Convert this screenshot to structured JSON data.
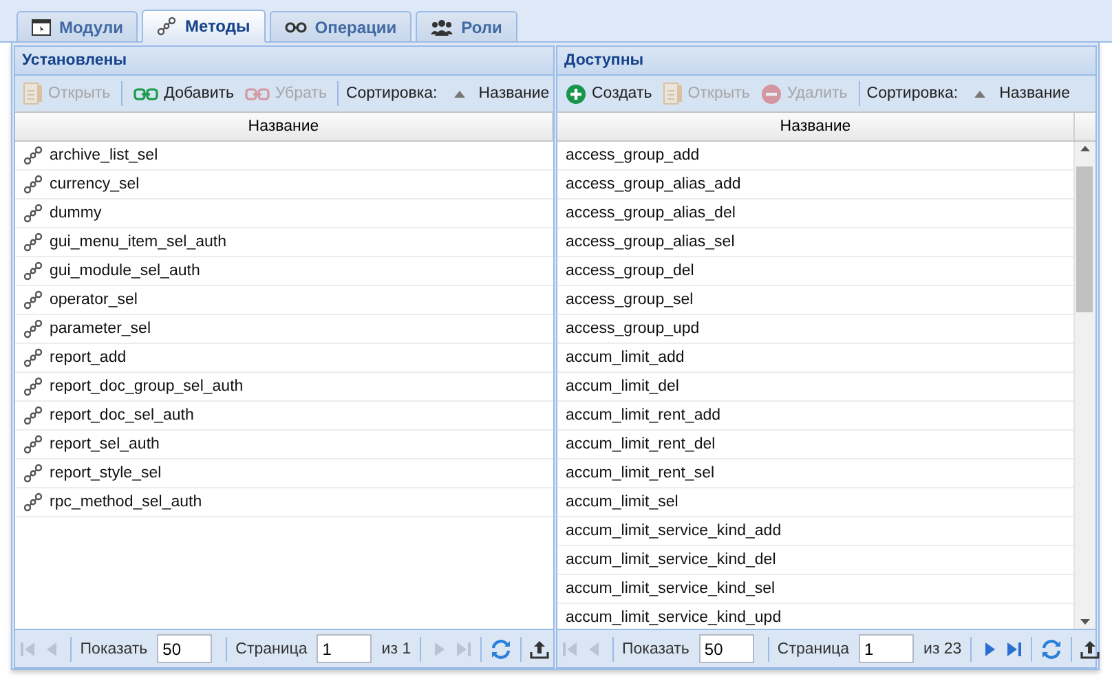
{
  "tabs": [
    {
      "label": "Модули",
      "selected": false
    },
    {
      "label": "Методы",
      "selected": true
    },
    {
      "label": "Операции",
      "selected": false
    },
    {
      "label": "Роли",
      "selected": false
    }
  ],
  "panels": [
    {
      "title": "Установлены",
      "toolbar": [
        {
          "kind": "open",
          "label": "Открыть",
          "disabled": true
        },
        {
          "kind": "add",
          "label": "Добавить",
          "disabled": false
        },
        {
          "kind": "remove",
          "label": "Убрать",
          "disabled": true
        }
      ],
      "sort_label": "Сортировка:",
      "sort_value": "Название",
      "column": "Название",
      "row_icons": true,
      "rows": [
        "archive_list_sel",
        "currency_sel",
        "dummy",
        "gui_menu_item_sel_auth",
        "gui_module_sel_auth",
        "operator_sel",
        "parameter_sel",
        "report_add",
        "report_doc_group_sel_auth",
        "report_doc_sel_auth",
        "report_sel_auth",
        "report_style_sel",
        "rpc_method_sel_auth"
      ],
      "pager": {
        "show_label": "Показать",
        "page_size": "50",
        "page_label": "Страница",
        "page": "1",
        "total": "из 1",
        "first_disabled": true,
        "prev_disabled": true,
        "next_disabled": true,
        "last_disabled": true
      }
    },
    {
      "title": "Доступны",
      "toolbar": [
        {
          "kind": "create",
          "label": "Создать",
          "disabled": false
        },
        {
          "kind": "open",
          "label": "Открыть",
          "disabled": true
        },
        {
          "kind": "delete",
          "label": "Удалить",
          "disabled": true
        }
      ],
      "sort_label": "Сортировка:",
      "sort_value": "Название",
      "column": "Название",
      "row_icons": false,
      "rows": [
        "access_group_add",
        "access_group_alias_add",
        "access_group_alias_del",
        "access_group_alias_sel",
        "access_group_del",
        "access_group_sel",
        "access_group_upd",
        "accum_limit_add",
        "accum_limit_del",
        "accum_limit_rent_add",
        "accum_limit_rent_del",
        "accum_limit_rent_sel",
        "accum_limit_sel",
        "accum_limit_service_kind_add",
        "accum_limit_service_kind_del",
        "accum_limit_service_kind_sel",
        "accum_limit_service_kind_upd"
      ],
      "pager": {
        "show_label": "Показать",
        "page_size": "50",
        "page_label": "Страница",
        "page": "1",
        "total": "из 23",
        "first_disabled": true,
        "prev_disabled": true,
        "next_disabled": false,
        "last_disabled": false
      }
    }
  ]
}
